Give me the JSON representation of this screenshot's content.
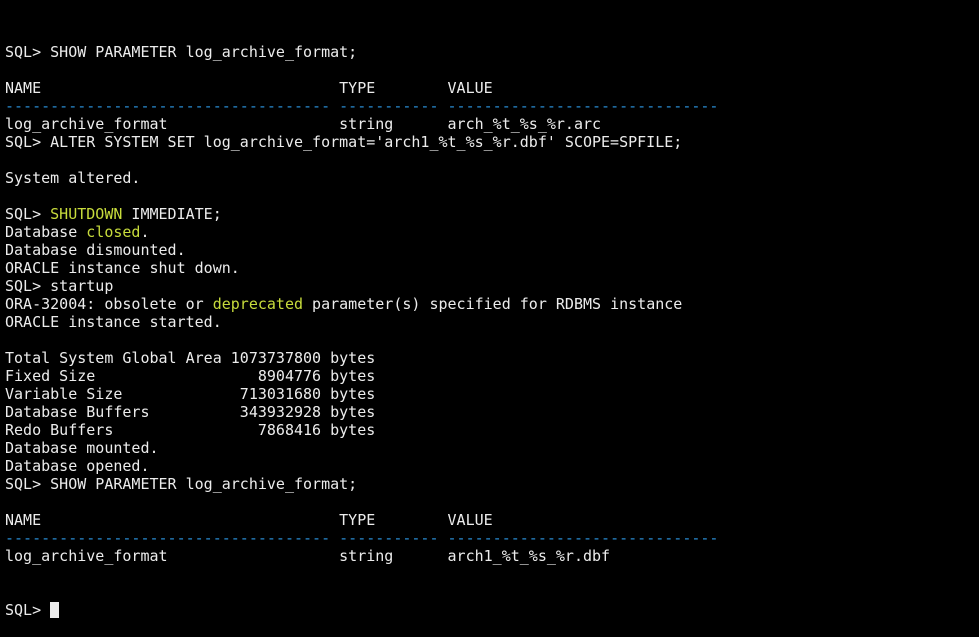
{
  "terminal": {
    "lines": [
      {
        "segments": [
          {
            "text": "SQL> SHOW PARAMETER log_archive_format;"
          }
        ]
      },
      {
        "segments": []
      },
      {
        "segments": [
          {
            "text": "NAME                                 TYPE        VALUE"
          }
        ]
      },
      {
        "segments": [
          {
            "text": "------------------------------------",
            "style": "dash"
          },
          {
            "text": " "
          },
          {
            "text": "-----------",
            "style": "dash"
          },
          {
            "text": " "
          },
          {
            "text": "------------------------------",
            "style": "dash"
          }
        ]
      },
      {
        "segments": [
          {
            "text": "log_archive_format                   string      arch_%t_%s_%r.arc"
          }
        ]
      },
      {
        "segments": [
          {
            "text": "SQL> ALTER SYSTEM SET log_archive_format='arch1_%t_%s_%r.dbf' SCOPE=SPFILE;"
          }
        ]
      },
      {
        "segments": []
      },
      {
        "segments": [
          {
            "text": "System altered."
          }
        ]
      },
      {
        "segments": []
      },
      {
        "segments": [
          {
            "text": "SQL> "
          },
          {
            "text": "SHUTDOWN",
            "style": "highlight"
          },
          {
            "text": " IMMEDIATE;"
          }
        ]
      },
      {
        "segments": [
          {
            "text": "Database "
          },
          {
            "text": "closed",
            "style": "highlight"
          },
          {
            "text": "."
          }
        ]
      },
      {
        "segments": [
          {
            "text": "Database dismounted."
          }
        ]
      },
      {
        "segments": [
          {
            "text": "ORACLE instance shut down."
          }
        ]
      },
      {
        "segments": [
          {
            "text": "SQL> startup"
          }
        ]
      },
      {
        "segments": [
          {
            "text": "ORA-32004: obsolete or "
          },
          {
            "text": "deprecated",
            "style": "highlight"
          },
          {
            "text": " parameter(s) specified for RDBMS instance"
          }
        ]
      },
      {
        "segments": [
          {
            "text": "ORACLE instance started."
          }
        ]
      },
      {
        "segments": []
      },
      {
        "segments": [
          {
            "text": "Total System Global Area 1073737800 bytes"
          }
        ]
      },
      {
        "segments": [
          {
            "text": "Fixed Size                  8904776 bytes"
          }
        ]
      },
      {
        "segments": [
          {
            "text": "Variable Size             713031680 bytes"
          }
        ]
      },
      {
        "segments": [
          {
            "text": "Database Buffers          343932928 bytes"
          }
        ]
      },
      {
        "segments": [
          {
            "text": "Redo Buffers                7868416 bytes"
          }
        ]
      },
      {
        "segments": [
          {
            "text": "Database mounted."
          }
        ]
      },
      {
        "segments": [
          {
            "text": "Database opened."
          }
        ]
      },
      {
        "segments": [
          {
            "text": "SQL> SHOW PARAMETER log_archive_format;"
          }
        ]
      },
      {
        "segments": []
      },
      {
        "segments": [
          {
            "text": "NAME                                 TYPE        VALUE"
          }
        ]
      },
      {
        "segments": [
          {
            "text": "------------------------------------",
            "style": "dash"
          },
          {
            "text": " "
          },
          {
            "text": "-----------",
            "style": "dash"
          },
          {
            "text": " "
          },
          {
            "text": "------------------------------",
            "style": "dash"
          }
        ]
      },
      {
        "segments": [
          {
            "text": "log_archive_format                   string      arch1_%t_%s_%r.dbf"
          }
        ]
      }
    ],
    "prompt": "SQL> ",
    "colors": {
      "background": "#000000",
      "foreground": "#ececec",
      "highlight": "#c8dc3c",
      "dash": "#2a8ed6",
      "cursor": "#ececec"
    }
  }
}
